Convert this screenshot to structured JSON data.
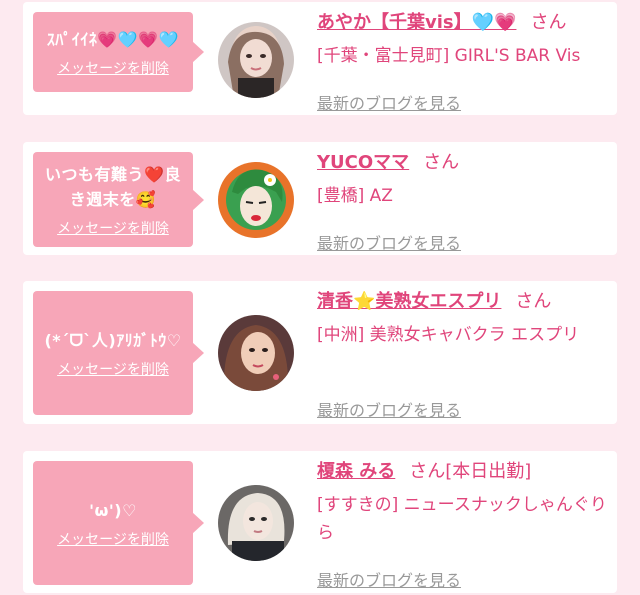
{
  "entries": [
    {
      "message": "ｽﾊﾟｲｲﾈ💗🩵💗🩵",
      "delete_label": "メッセージを削除",
      "name": "あやか【千葉vis】🩵💗",
      "honorific": "さん",
      "shop": "[千葉・富士見町] GIRL'S BAR Vis",
      "blog_link": "最新のブログを見る"
    },
    {
      "message": "いつも有難う❤️良き週末を🥰",
      "delete_label": "メッセージを削除",
      "name": "YUCOママ",
      "honorific": "さん",
      "shop": "[豊橋] AZ",
      "blog_link": "最新のブログを見る"
    },
    {
      "message": "(*ˊᗜˋ人)ｱﾘｶﾞﾄｳ♡",
      "delete_label": "メッセージを削除",
      "name": "清香⭐美熟女エスプリ",
      "honorific": "さん",
      "shop": "[中洲] 美熟女キャバクラ エスプリ",
      "blog_link": "最新のブログを見る"
    },
    {
      "message": "'ω')♡",
      "delete_label": "メッセージを削除",
      "name": "榎森 みる",
      "honorific": "さん",
      "status": "[本日出勤]",
      "shop": "[すすきの] ニュースナックしゃんぐりら",
      "blog_link": "最新のブログを見る"
    }
  ],
  "colors": {
    "accent": "#e0457b",
    "bubble": "#f7a6b8",
    "background": "#fdeaf0",
    "muted": "#999999"
  }
}
